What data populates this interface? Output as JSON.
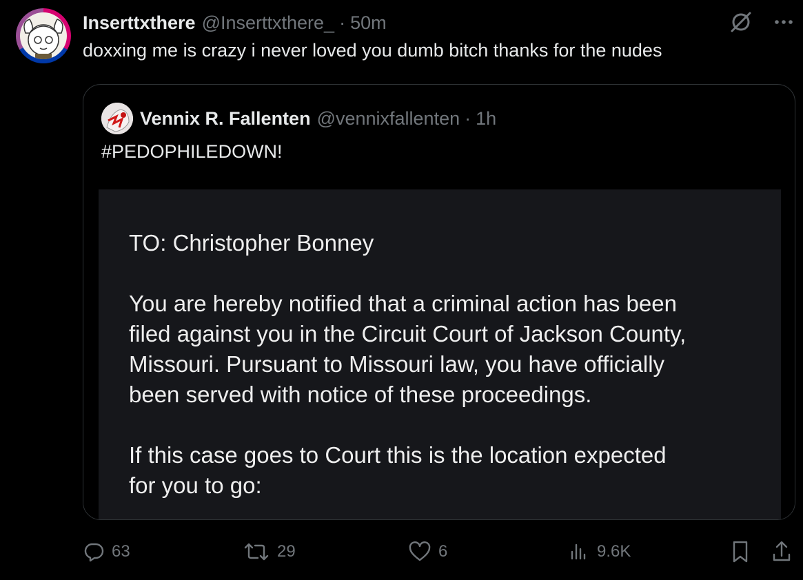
{
  "tweet": {
    "author_name": "Inserttxthere",
    "author_handle": "@Inserttxthere_",
    "separator": "·",
    "time": "50m",
    "text": "doxxing me is crazy i never loved you dumb bitch thanks for the nudes",
    "icons": [
      "grok-icon",
      "more-icon"
    ]
  },
  "quoted_tweet": {
    "author_name": "Vennix R. Fallenten",
    "author_handle": "@vennixfallenten",
    "separator": "·",
    "time": "1h",
    "text": "#PEDOPHILEDOWN!",
    "image_text": {
      "line1": "TO: Christopher Bonney",
      "para2_l1": "You are hereby notified that a criminal action has been",
      "para2_l2": "filed against you in the Circuit Court of Jackson County,",
      "para2_l3": "Missouri. Pursuant to Missouri law, you have officially",
      "para2_l4": "been served with notice of these proceedings.",
      "para3_l1": "If this case goes to Court this is the location expected",
      "para3_l2": "for you to go:"
    }
  },
  "actions": {
    "replies": "63",
    "reposts": "29",
    "likes": "6",
    "views": "9.6K"
  },
  "colors": {
    "background": "#000000",
    "text_primary": "#e7e9ea",
    "text_secondary": "#71767b",
    "border": "#2f3336",
    "avatar_ring": [
      "#d60270",
      "#9b4f96",
      "#0038a8"
    ]
  }
}
